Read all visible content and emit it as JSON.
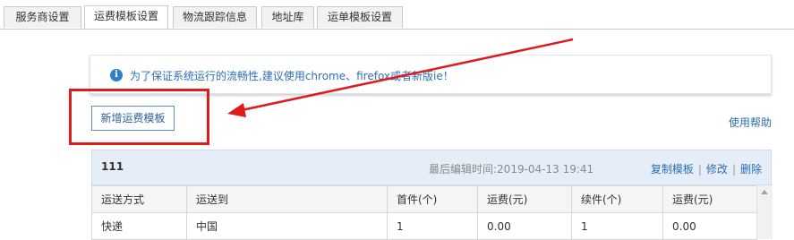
{
  "tabs": [
    {
      "label": "服务商设置"
    },
    {
      "label": "运费模板设置",
      "active": true
    },
    {
      "label": "物流跟踪信息"
    },
    {
      "label": "地址库"
    },
    {
      "label": "运单模板设置"
    }
  ],
  "notice": {
    "icon": "info-icon",
    "text": "为了保证系统运行的流畅性,建议使用chrome、firefox或者新版ie！"
  },
  "toolbar": {
    "add_label": "新增运费模板",
    "help_label": "使用帮助"
  },
  "template": {
    "name": "111",
    "last_edited_label": "最后编辑时间:2019-04-13 19:41",
    "actions": {
      "copy": "复制模板",
      "edit": "修改",
      "delete": "删除"
    },
    "columns": [
      "运送方式",
      "运送到",
      "首件(个)",
      "运费(元)",
      "续件(个)",
      "运费(元)"
    ],
    "rows": [
      [
        "快递",
        "中国",
        "1",
        "0.00",
        "1",
        "0.00"
      ]
    ]
  },
  "colors": {
    "annotation": "#e01b1b",
    "link": "#2c6db0",
    "notice_text": "#2f6fb5",
    "panel_header_bg": "#e5eef8"
  }
}
